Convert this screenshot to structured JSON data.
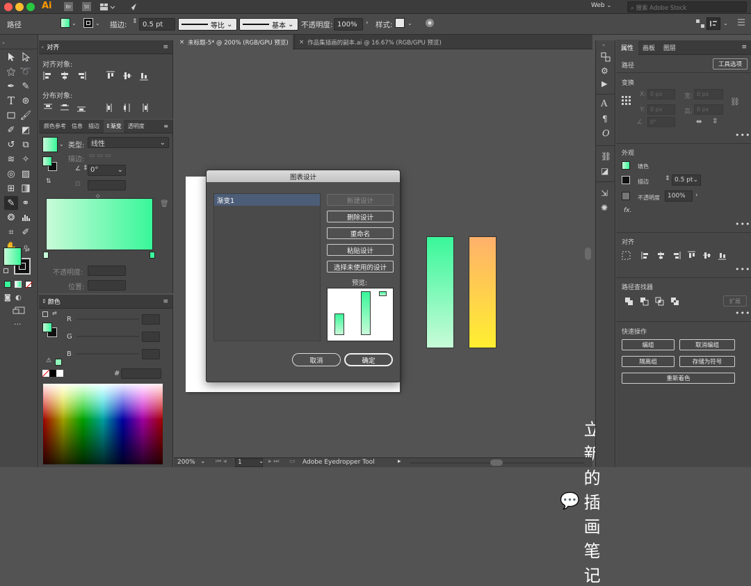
{
  "app": {
    "logo": "Ai",
    "icons": [
      "Br",
      "St"
    ],
    "workspace": "Web",
    "search_placeholder": "搜索 Adobe Stock"
  },
  "control_bar": {
    "object_type": "路径",
    "stroke_label": "描边:",
    "stroke_value": "0.5 pt",
    "profile_label": "等比",
    "brush_label": "基本",
    "opacity_label": "不透明度:",
    "opacity_value": "100%",
    "style_label": "样式:"
  },
  "doc_tabs": [
    {
      "label": "未标题-5* @ 200% (RGB/GPU 预览)",
      "active": true
    },
    {
      "label": "作品集插画的副本.ai @ 16.67% (RGB/GPU 预览)",
      "active": false
    }
  ],
  "align_panel": {
    "tab": "对齐",
    "align_objects": "对齐对象:",
    "distribute_objects": "分布对象:"
  },
  "gradient_panel": {
    "tabs": [
      "颜色参考",
      "信息",
      "描边",
      "渐变",
      "透明度"
    ],
    "active_tab": "渐变",
    "type_label": "类型:",
    "type_value": "线性",
    "stroke_label": "描边:",
    "angle_value": "0°",
    "opacity_label": "不透明度:",
    "position_label": "位置:"
  },
  "color_panel": {
    "tab": "颜色",
    "r": "R",
    "g": "G",
    "b": "B",
    "hex": "#"
  },
  "dialog": {
    "title": "图表设计",
    "list_items": [
      "渐变1"
    ],
    "buttons": {
      "new": "新建设计",
      "delete": "删除设计",
      "rename": "重命名",
      "paste": "粘贴设计",
      "select_unused": "选择未使用的设计"
    },
    "preview_label": "预览:",
    "cancel": "取消",
    "ok": "确定"
  },
  "right_panel": {
    "tabs": [
      "属性",
      "画板",
      "图层"
    ],
    "path_label": "路径",
    "tool_options": "工具选项",
    "transform": "变换",
    "x_label": "X:",
    "y_label": "Y:",
    "w_label": "宽:",
    "h_label": "高:",
    "x_val": "0 px",
    "y_val": "0 px",
    "w_val": "0 px",
    "h_val": "0 px",
    "angle_val": "0°",
    "appearance": "外观",
    "fill_label": "填色",
    "stroke_label": "描边",
    "stroke_value": "0.5 pt",
    "opacity_label": "不透明度",
    "opacity_value": "100%",
    "fx": "fx.",
    "align": "对齐",
    "pathfinder": "路径查找器",
    "expand": "扩展",
    "quick_actions": "快速操作",
    "qa_buttons": [
      "编组",
      "取消编组",
      "隔离组",
      "存储为符号",
      "重新着色"
    ]
  },
  "status": {
    "zoom": "200%",
    "page": "1",
    "tool_name": "Adobe Eyedropper Tool"
  },
  "watermark": "立新的插画笔记",
  "colors": {
    "green": "#39f79a",
    "green_light": "#c8fbd8",
    "orange": "#ffb06b",
    "yellow": "#ffef30",
    "dialog_select": "#4c5d78"
  }
}
